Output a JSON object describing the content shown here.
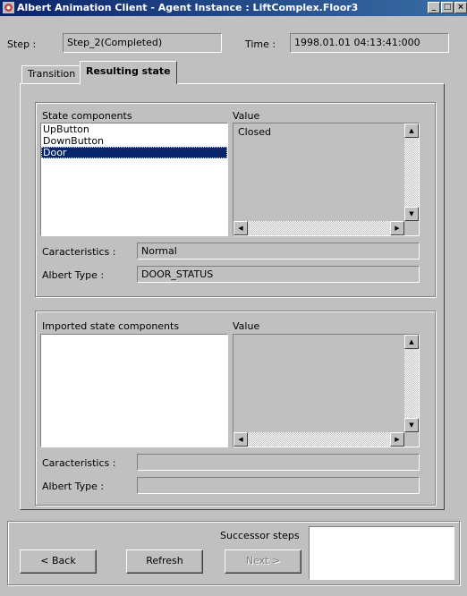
{
  "window": {
    "title": "Albert Animation Client - Agent Instance : LiftComplex.Floor3",
    "minimize": "_",
    "maximize": "□",
    "close": "×"
  },
  "header": {
    "step_label": "Step :",
    "step_value": "Step_2(Completed)",
    "time_label": "Time :",
    "time_value": "1998.01.01 04:13:41:000"
  },
  "tabs": [
    {
      "label": "Transition",
      "active": false
    },
    {
      "label": "Resulting state",
      "active": true
    }
  ],
  "state_panel": {
    "components_label": "State components",
    "value_label": "Value",
    "items": [
      "UpButton",
      "DownButton",
      "Door"
    ],
    "selected_index": 2,
    "value_text": "Closed",
    "caracteristics_label": "Caracteristics :",
    "caracteristics_value": "Normal",
    "albert_type_label": "Albert Type :",
    "albert_type_value": "DOOR_STATUS"
  },
  "imported_panel": {
    "components_label": "Imported state components",
    "value_label": "Value",
    "caracteristics_label": "Caracteristics :",
    "caracteristics_value": "",
    "albert_type_label": "Albert Type :",
    "albert_type_value": ""
  },
  "footer": {
    "back_label": "< Back",
    "refresh_label": "Refresh",
    "next_label": "Next >",
    "successor_label": "Successor steps"
  },
  "icons": {
    "scroll_up": "▲",
    "scroll_down": "▼",
    "scroll_left": "◀",
    "scroll_right": "▶"
  }
}
